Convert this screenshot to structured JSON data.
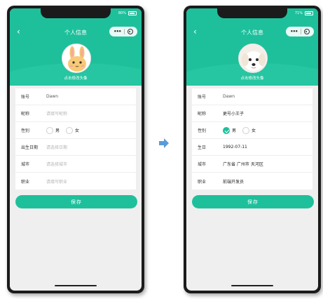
{
  "colors": {
    "primary": "#1ec09c",
    "arrow": "#5b9bd5"
  },
  "before": {
    "status": "80%",
    "nav_title": "个人信息",
    "avatar_label": "点击修改头像",
    "fields": [
      {
        "label": "账号",
        "value": "Dawn",
        "kind": "text"
      },
      {
        "label": "昵称",
        "value": "请填写昵称",
        "kind": "placeholder"
      },
      {
        "label": "性别",
        "options": [
          "男",
          "女"
        ],
        "selected": ""
      },
      {
        "label": "出生日期",
        "value": "请选择日期",
        "kind": "placeholder"
      },
      {
        "label": "城市",
        "value": "请选择城市",
        "kind": "placeholder"
      },
      {
        "label": "职业",
        "value": "请填写职业",
        "kind": "placeholder"
      }
    ],
    "save_label": "保存"
  },
  "after": {
    "status": "71%",
    "nav_title": "个人信息",
    "avatar_label": "点击修改头像",
    "fields": [
      {
        "label": "账号",
        "value": "Dawn",
        "kind": "text"
      },
      {
        "label": "昵称",
        "value": "更号小王子",
        "kind": "filled"
      },
      {
        "label": "性别",
        "options": [
          "男",
          "女"
        ],
        "selected": "男"
      },
      {
        "label": "生日",
        "value": "1992-07-11",
        "kind": "filled"
      },
      {
        "label": "城市",
        "value": "广东省 广州市 天河区",
        "kind": "filled"
      },
      {
        "label": "职业",
        "value": "前端开发员",
        "kind": "filled"
      }
    ],
    "save_label": "保存"
  }
}
